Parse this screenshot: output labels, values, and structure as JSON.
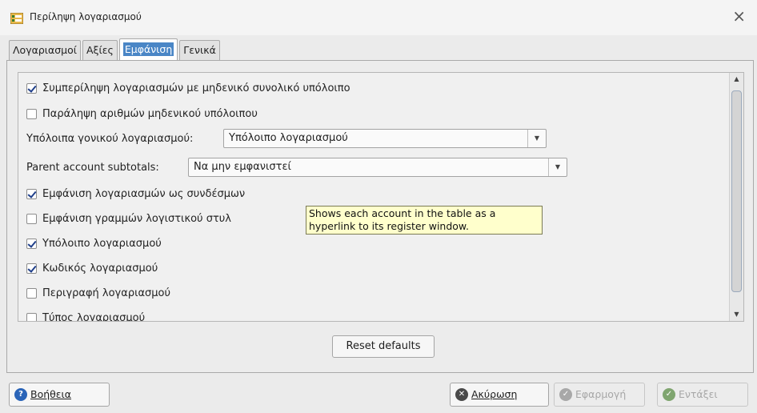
{
  "window": {
    "title": "Περίληψη λογαριασμού",
    "close_icon": "×"
  },
  "tabs": [
    {
      "label": "Λογαριασμοί",
      "active": false
    },
    {
      "label": "Αξίες",
      "active": false
    },
    {
      "label": "Εμφάνιση",
      "active": true
    },
    {
      "label": "Γενικά",
      "active": false
    }
  ],
  "options": {
    "include_zero_total": {
      "label": "Συμπερίληψη λογαριασμών με μηδενικό συνολικό υπόλοιπο",
      "checked": true
    },
    "omit_zero_amounts": {
      "label": "Παράληψη αριθμών μηδενικού υπόλοιπου",
      "checked": false
    },
    "parent_balances": {
      "label": "Υπόλοιπα γονικού λογαριασμού:",
      "value": "Υπόλοιπο λογαριασμού"
    },
    "parent_subtotals": {
      "label": "Parent account subtotals:",
      "value": "Να μην εμφανιστεί"
    },
    "show_as_links": {
      "label": "Εμφάνιση λογαριασμών ως συνδέσμων",
      "checked": true
    },
    "ledger_lines": {
      "label": "Εμφάνιση γραμμών λογιστικού στυλ",
      "checked": false
    },
    "account_balance": {
      "label": "Υπόλοιπο λογαριασμού",
      "checked": true
    },
    "account_code": {
      "label": "Κωδικός λογαριασμού",
      "checked": true
    },
    "account_description": {
      "label": "Περιγραφή λογαριασμού",
      "checked": false
    },
    "account_type": {
      "label": "Τύπος λογαριασμού",
      "checked": false
    }
  },
  "tooltip": {
    "line1": "Shows each account in the table as a",
    "line2": "hyperlink to its register window."
  },
  "reset_button": "Reset defaults",
  "buttons": {
    "help": {
      "label": "Βοήθεια",
      "icon": "help-icon"
    },
    "cancel": {
      "label": "Ακύρωση",
      "icon": "cancel-icon"
    },
    "apply": {
      "label": "Εφαρμογή",
      "icon": "apply-icon",
      "disabled": true
    },
    "ok": {
      "label": "Εντάξει",
      "icon": "ok-icon",
      "disabled": true
    }
  },
  "colors": {
    "selection": "#4a86c6",
    "tooltip_bg": "#ffffcc",
    "help_icon": "#2a64b8"
  }
}
